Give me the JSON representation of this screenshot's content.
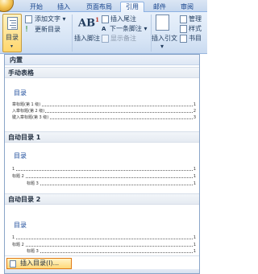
{
  "tabs": [
    {
      "label": "开始",
      "active": false
    },
    {
      "label": "插入",
      "active": false
    },
    {
      "label": "页面布局",
      "active": false
    },
    {
      "label": "引用",
      "active": true
    },
    {
      "label": "邮件",
      "active": false
    },
    {
      "label": "审阅",
      "active": false
    }
  ],
  "ribbon": {
    "toc_label": "目录",
    "add_text_label": "添加文字",
    "update_toc_label": "更新目录",
    "ab_symbol": "AB",
    "ab_superscript": "1",
    "insert_footnote_label": "插入脚注",
    "insert_endnote_label": "插入尾注",
    "next_footnote_label": "下一条脚注",
    "show_notes_label": "显示备注",
    "insert_citation_label": "插入引文",
    "manage_label": "管理",
    "style_label": "样式",
    "bibliography_label": "书目"
  },
  "menu": {
    "header": "内置",
    "sections": [
      {
        "title": "手动表格",
        "heading": "目录",
        "rows": [
          {
            "text": "章标题(第 1 级)",
            "page": "1",
            "indent": 0
          },
          {
            "text": "入章标题(第 2 级)",
            "page": "2",
            "indent": 0
          },
          {
            "text": "键入章标题(第 3 级)",
            "page": "3",
            "indent": 0
          }
        ]
      },
      {
        "title": "自动目录 1",
        "heading": "目录",
        "rows": [
          {
            "text": "1",
            "page": "1",
            "indent": 0
          },
          {
            "text": "标题 2",
            "page": "1",
            "indent": 1
          },
          {
            "text": "标题 3",
            "page": "1",
            "indent": 2
          }
        ]
      },
      {
        "title": "自动目录 2",
        "heading": "目录",
        "rows": [
          {
            "text": "1",
            "page": "1",
            "indent": 0
          },
          {
            "text": "标题 2",
            "page": "1",
            "indent": 1
          },
          {
            "text": "标题 3",
            "page": "1",
            "indent": 2
          }
        ]
      }
    ],
    "insert_toc_label": "插入目录(I)..."
  },
  "colors": {
    "accent": "#15428b",
    "highlight_border": "#e07a14"
  }
}
